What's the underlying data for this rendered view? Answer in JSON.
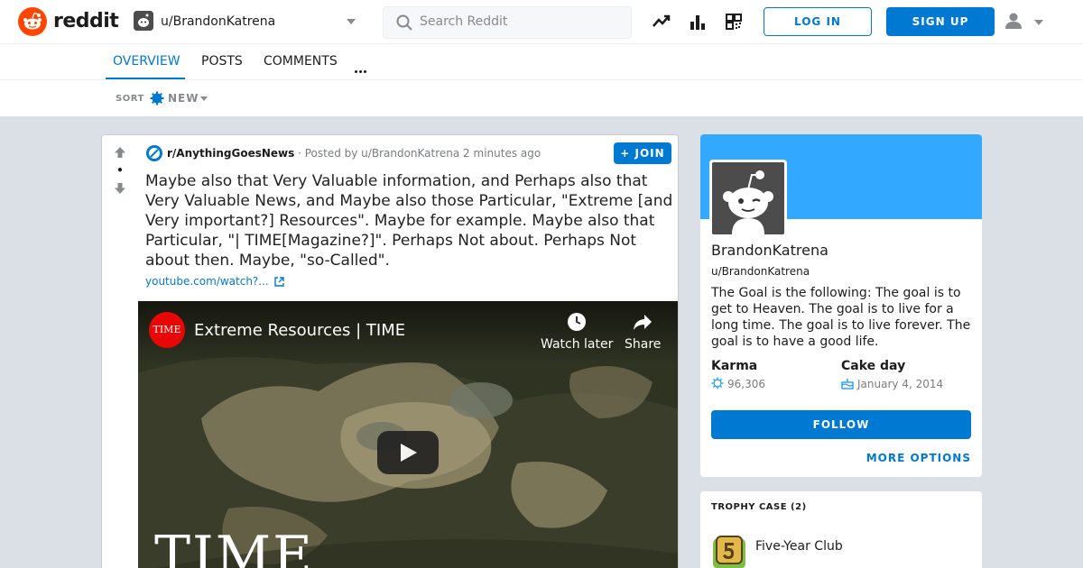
{
  "header": {
    "wordmark": "reddit",
    "username": "u/BrandonKatrena",
    "search_placeholder": "Search Reddit",
    "login_label": "LOG IN",
    "signup_label": "SIGN UP"
  },
  "tabs": [
    {
      "label": "OVERVIEW",
      "active": true
    },
    {
      "label": "POSTS",
      "active": false
    },
    {
      "label": "COMMENTS",
      "active": false
    }
  ],
  "sort": {
    "label": "SORT",
    "value": "NEW"
  },
  "post": {
    "score": "•",
    "subreddit": "r/AnythingGoesNews",
    "posted_by": "· Posted by u/BrandonKatrena 2 minutes ago",
    "join_label": "JOIN",
    "title": "Maybe also that Very Valuable information, and Perhaps also that Very Valuable News, and Maybe also those Particular, \"Extreme [and Very important?] Resources\". Maybe for example. Maybe also that Particular, \"| TIME[Magazine?]\". Perhaps Not about. Perhaps Not about then. Maybe, \"so-Called\".",
    "link_text": "youtube.com/watch?...",
    "video": {
      "channel_logo_text": "TIME",
      "title": "Extreme Resources | TIME",
      "watch_later": "Watch later",
      "share": "Share",
      "overlay_text": "TIME"
    }
  },
  "profile": {
    "display_name": "BrandonKatrena",
    "handle": "u/BrandonKatrena",
    "bio": "The Goal is the following: The goal is to get to Heaven. The goal is to live for a long time. The goal is to live forever. The goal is to have a good life.",
    "karma_label": "Karma",
    "karma_value": "96,306",
    "cakeday_label": "Cake day",
    "cakeday_value": "January 4, 2014",
    "follow_label": "FOLLOW",
    "more_options_label": "MORE OPTIONS"
  },
  "trophy_case": {
    "title": "TROPHY CASE (2)",
    "items": [
      {
        "name": "Five-Year Club",
        "icon": "five-year-club-icon"
      }
    ]
  },
  "colors": {
    "accent": "#0079d3",
    "brand": "#ff4500",
    "banner": "#33a8ff",
    "background": "#dae0e6"
  }
}
